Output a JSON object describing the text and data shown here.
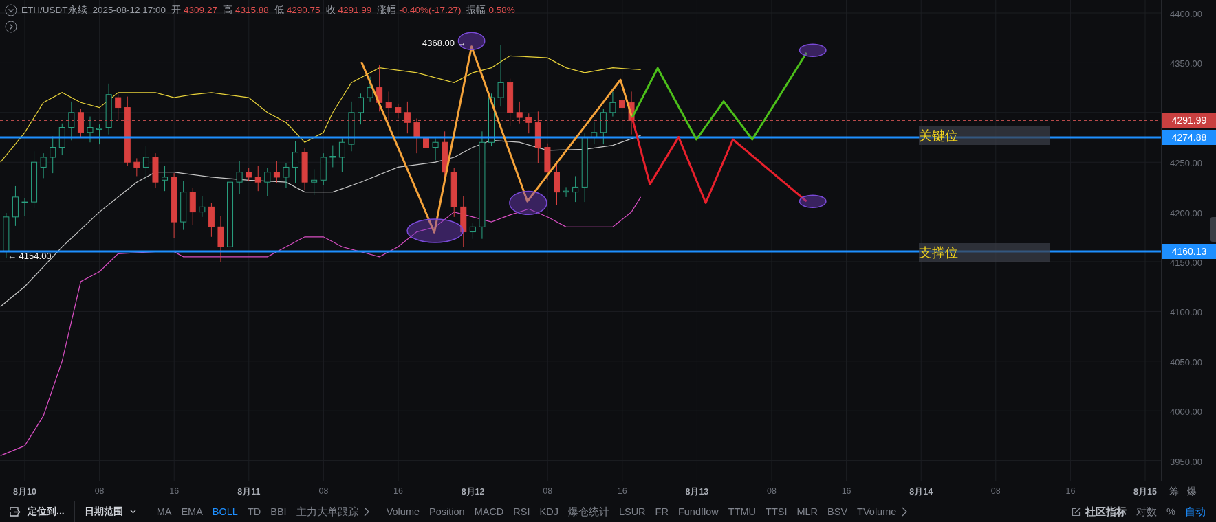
{
  "header": {
    "symbol": "ETH/USDT永续",
    "time": "2025-08-12 17:00",
    "fields": [
      {
        "label": "开",
        "value": "4309.27"
      },
      {
        "label": "高",
        "value": "4315.88"
      },
      {
        "label": "低",
        "value": "4290.75"
      },
      {
        "label": "收",
        "value": "4291.99"
      },
      {
        "label": "涨幅",
        "value": "-0.40%(-17.27)"
      },
      {
        "label": "振幅",
        "value": "0.58%"
      }
    ]
  },
  "annotations": {
    "high_marker": "4368.00 →",
    "low_marker": "← 4154.00"
  },
  "levels": [
    {
      "label": "关键位"
    },
    {
      "label": "支撑位"
    }
  ],
  "y_axis": {
    "ticks": [
      "4400.00",
      "4350.00",
      "4250.00",
      "4200.00",
      "4150.00",
      "4100.00",
      "4050.00",
      "4000.00",
      "3950.00"
    ],
    "price_tags": [
      {
        "label": "4291.99",
        "kind": "last"
      },
      {
        "label": "4274.88",
        "kind": "level"
      },
      {
        "label": "4160.13",
        "kind": "level"
      }
    ]
  },
  "x_axis": {
    "ticks": [
      {
        "label": "8月10",
        "kind": "date"
      },
      {
        "label": "08",
        "kind": "hour"
      },
      {
        "label": "16",
        "kind": "hour"
      },
      {
        "label": "8月11",
        "kind": "date"
      },
      {
        "label": "08",
        "kind": "hour"
      },
      {
        "label": "16",
        "kind": "hour"
      },
      {
        "label": "8月12",
        "kind": "date"
      },
      {
        "label": "08",
        "kind": "hour"
      },
      {
        "label": "16",
        "kind": "hour"
      },
      {
        "label": "8月13",
        "kind": "date"
      },
      {
        "label": "08",
        "kind": "hour"
      },
      {
        "label": "16",
        "kind": "hour"
      },
      {
        "label": "8月14",
        "kind": "date"
      },
      {
        "label": "08",
        "kind": "hour"
      },
      {
        "label": "16",
        "kind": "hour"
      },
      {
        "label": "8月15",
        "kind": "date"
      }
    ],
    "corner": [
      "筹",
      "爆"
    ]
  },
  "toolbar": {
    "locate": "定位到...",
    "date_range": "日期范围",
    "main_indicators": [
      {
        "label": "MA",
        "selected": false
      },
      {
        "label": "EMA",
        "selected": false
      },
      {
        "label": "BOLL",
        "selected": true
      },
      {
        "label": "TD",
        "selected": false
      },
      {
        "label": "BBI",
        "selected": false
      },
      {
        "label": "主力大单跟踪",
        "selected": false
      }
    ],
    "sub_indicators": [
      {
        "label": "Volume",
        "selected": false
      },
      {
        "label": "Position",
        "selected": false
      },
      {
        "label": "MACD",
        "selected": false
      },
      {
        "label": "RSI",
        "selected": false
      },
      {
        "label": "KDJ",
        "selected": false
      },
      {
        "label": "爆仓统计",
        "selected": false
      },
      {
        "label": "LSUR",
        "selected": false
      },
      {
        "label": "FR",
        "selected": false
      },
      {
        "label": "Fundflow",
        "selected": false
      },
      {
        "label": "TTMU",
        "selected": false
      },
      {
        "label": "TTSI",
        "selected": false
      },
      {
        "label": "MLR",
        "selected": false
      },
      {
        "label": "BSV",
        "selected": false
      },
      {
        "label": "TVolume",
        "selected": false
      }
    ],
    "community": "社区指标",
    "scales": [
      {
        "label": "对数",
        "selected": false
      },
      {
        "label": "%",
        "selected": false
      },
      {
        "label": "自动",
        "selected": true
      }
    ]
  }
}
